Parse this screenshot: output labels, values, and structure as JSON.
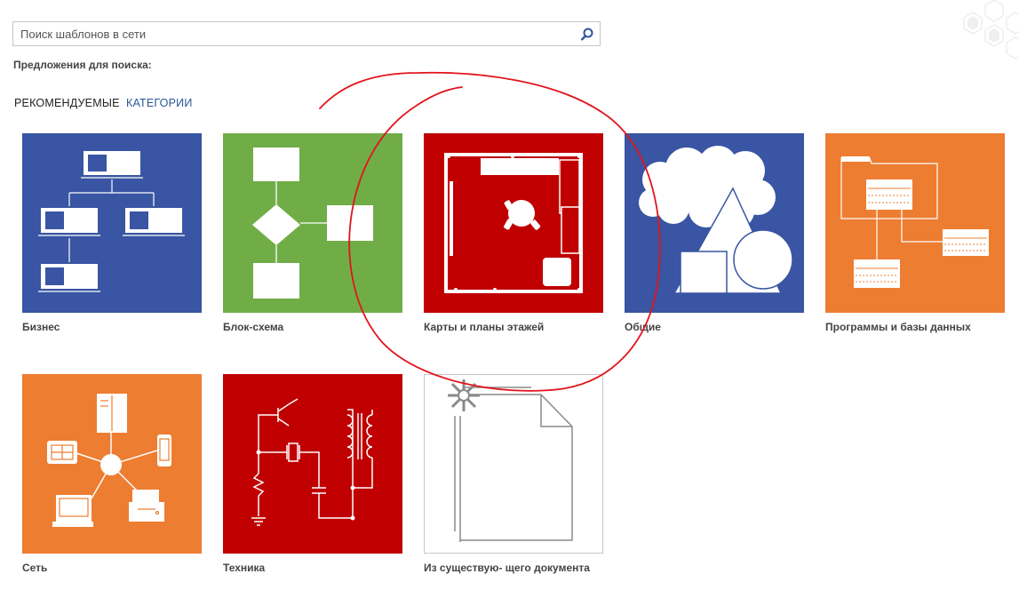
{
  "search": {
    "placeholder": "Поиск шаблонов в сети",
    "value": ""
  },
  "suggestions_label": "Предложения для поиска:",
  "tabs": {
    "featured": "РЕКОМЕНДУЕМЫЕ",
    "categories": "КАТЕГОРИИ"
  },
  "colors": {
    "blue": "#3955a3",
    "green": "#70ad47",
    "red": "#c00000",
    "orange": "#ed7d31",
    "link": "#2b579a",
    "annotation": "#e2141c"
  },
  "tiles": [
    {
      "label": "Бизнес",
      "icon": "org-chart-icon"
    },
    {
      "label": "Блок-схема",
      "icon": "flowchart-icon"
    },
    {
      "label": "Карты и планы этажей",
      "icon": "floor-plan-icon"
    },
    {
      "label": "Общие",
      "icon": "basic-shapes-icon"
    },
    {
      "label": "Программы и базы данных",
      "icon": "database-diagram-icon"
    },
    {
      "label": "Сеть",
      "icon": "network-icon"
    },
    {
      "label": "Техника",
      "icon": "circuit-icon"
    },
    {
      "label": "Из существую- щего документа",
      "icon": "new-from-existing-icon"
    }
  ]
}
